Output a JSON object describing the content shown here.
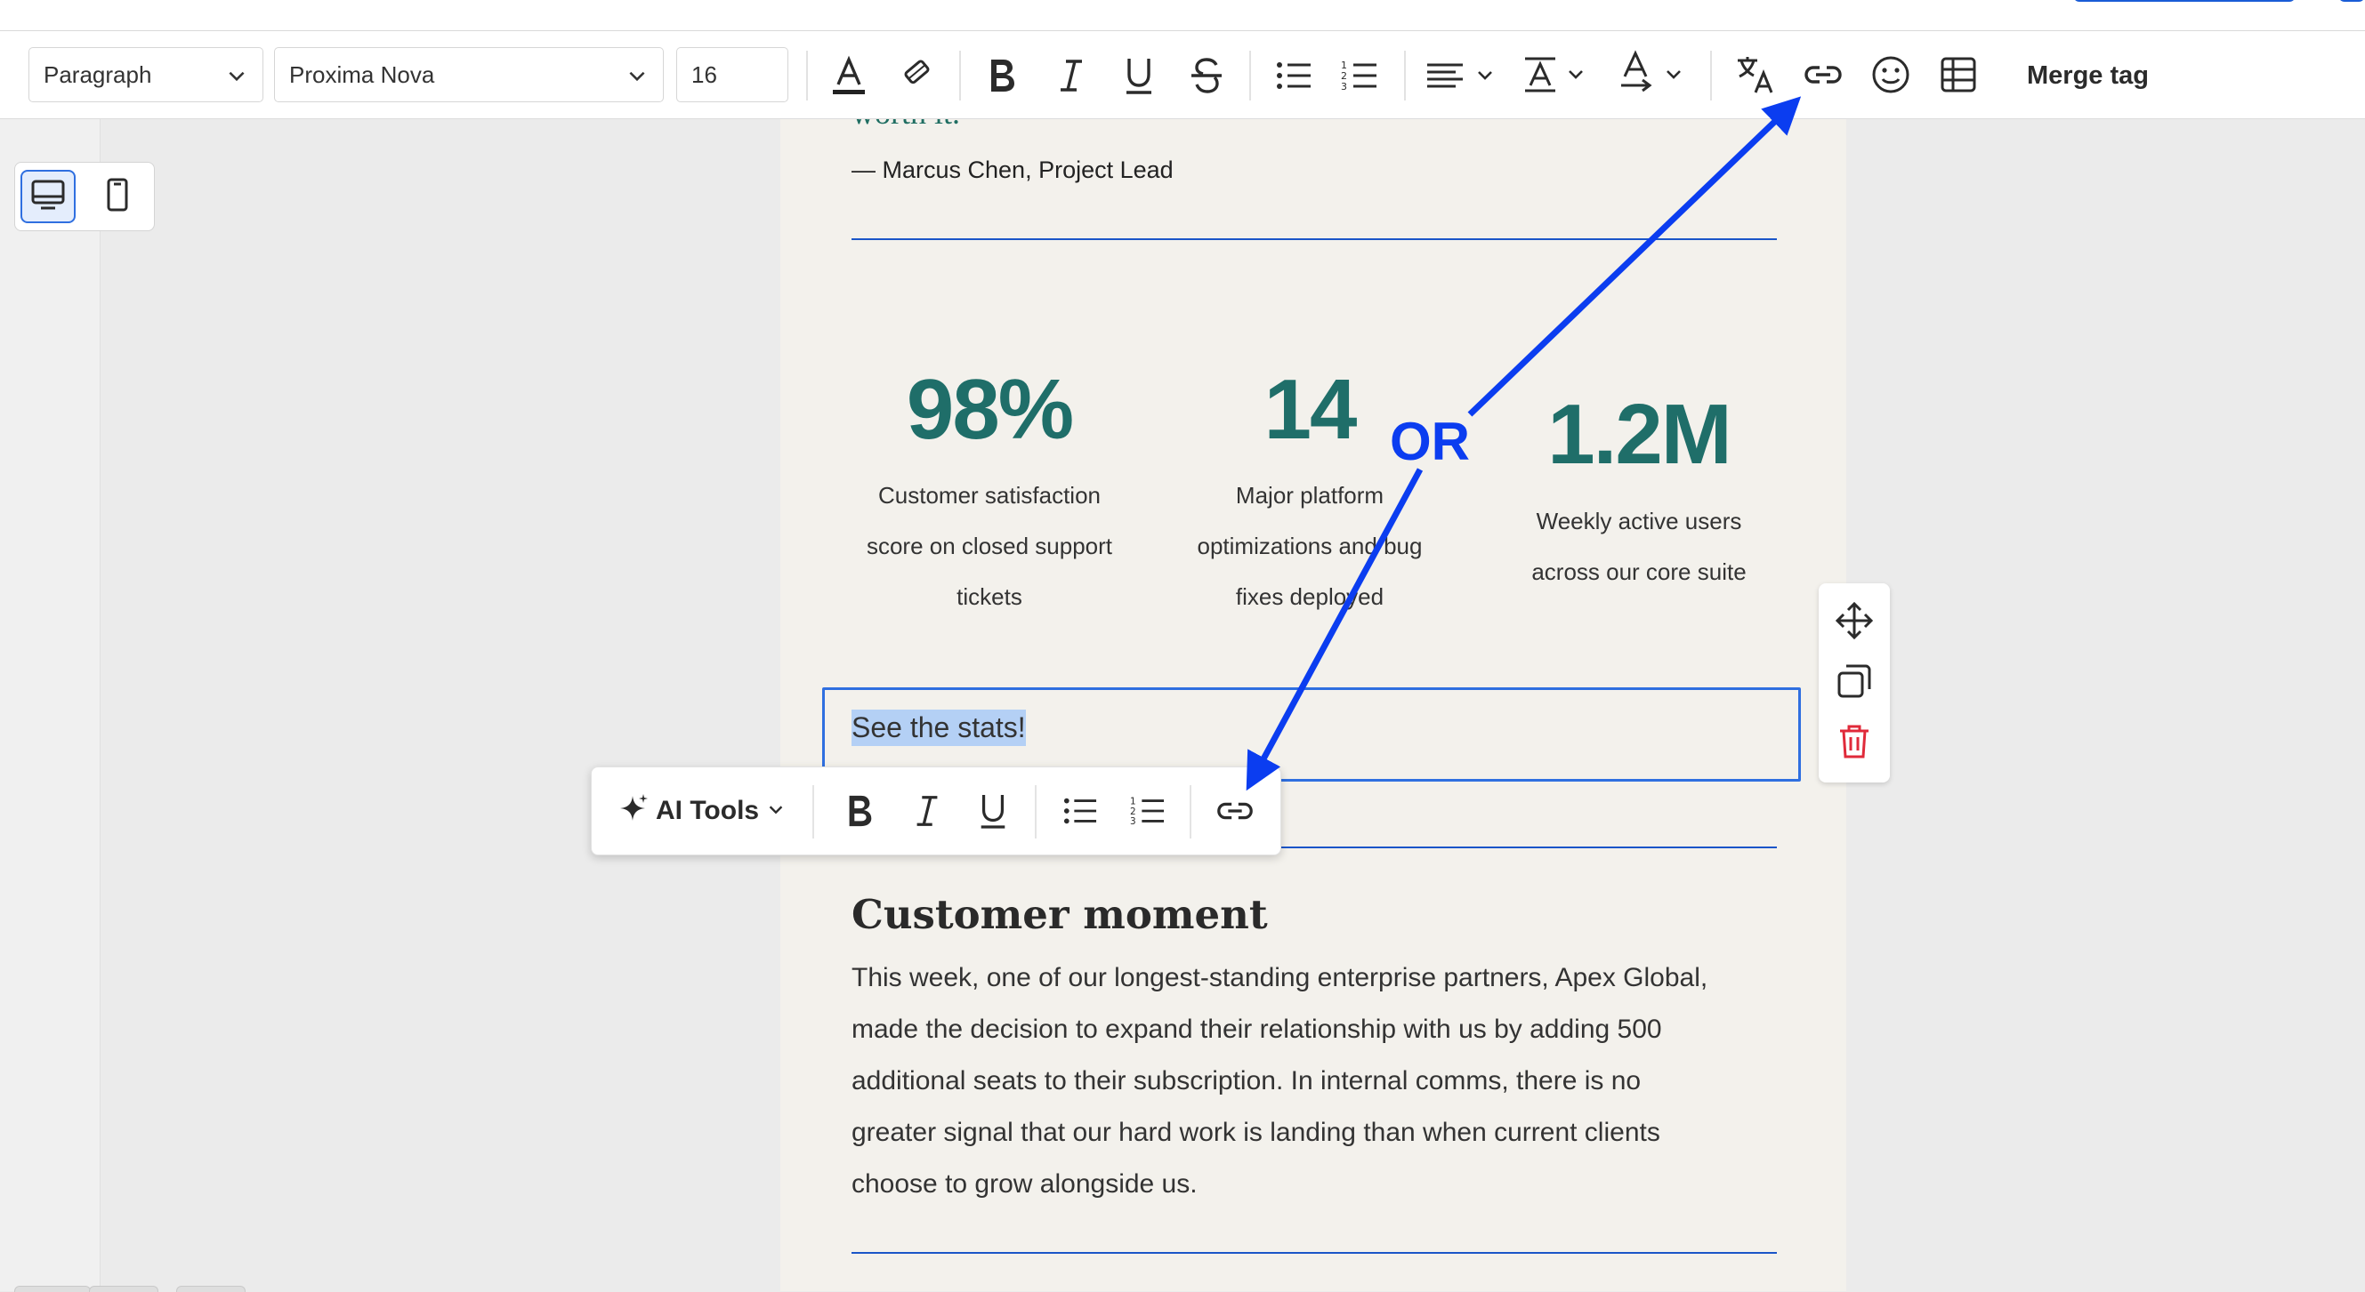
{
  "toolbar": {
    "block_style": "Paragraph",
    "font_family": "Proxima Nova",
    "font_size": "16",
    "merge_tag": "Merge tag",
    "icons": [
      "text-color-icon",
      "highlight-icon",
      "bold-icon",
      "italic-icon",
      "underline-icon",
      "strikethrough-icon",
      "bulleted-list-icon",
      "numbered-list-icon",
      "align-icon",
      "text-format-icon",
      "text-direction-icon",
      "translate-icon",
      "link-icon",
      "emoji-icon",
      "table-icon"
    ]
  },
  "device_toggle": {
    "desktop": "desktop-icon",
    "mobile": "mobile-icon",
    "active": "desktop"
  },
  "content": {
    "quote_tail": "worth it.",
    "author": "— Marcus Chen, Project Lead",
    "stats": [
      {
        "value": "98%",
        "desc": [
          "Customer satisfaction",
          "score on closed support",
          "tickets"
        ]
      },
      {
        "value": "14",
        "desc": [
          "Major platform",
          "optimizations and bug",
          "fixes deployed"
        ]
      },
      {
        "value": "1.2M",
        "desc": [
          "Weekly active users",
          "across our core suite"
        ]
      }
    ],
    "selected_text": "See the stats!",
    "heading": "Customer moment",
    "paragraph_lines": [
      "This week, one of our longest-standing enterprise partners, Apex Global,",
      "made the decision to expand their relationship with us by adding 500",
      "additional seats to their subscription. In internal comms, there is no",
      "greater signal that our hard work is landing than when current clients",
      "choose to grow alongside us."
    ]
  },
  "floating_toolbar": {
    "ai_tools": "AI Tools",
    "icons": [
      "sparkle-icon",
      "bold-icon",
      "italic-icon",
      "underline-icon",
      "bulleted-list-icon",
      "numbered-list-icon",
      "link-icon"
    ]
  },
  "block_tools": [
    "move-icon",
    "duplicate-icon",
    "delete-icon"
  ],
  "annotation": {
    "label": "OR",
    "color": "#0b3df0"
  },
  "colors": {
    "accent": "#2f6fe0",
    "stat": "#1f6e69",
    "divider": "#1a55c8",
    "delete": "#e02a3a",
    "canvas": "#f3f1ec"
  }
}
